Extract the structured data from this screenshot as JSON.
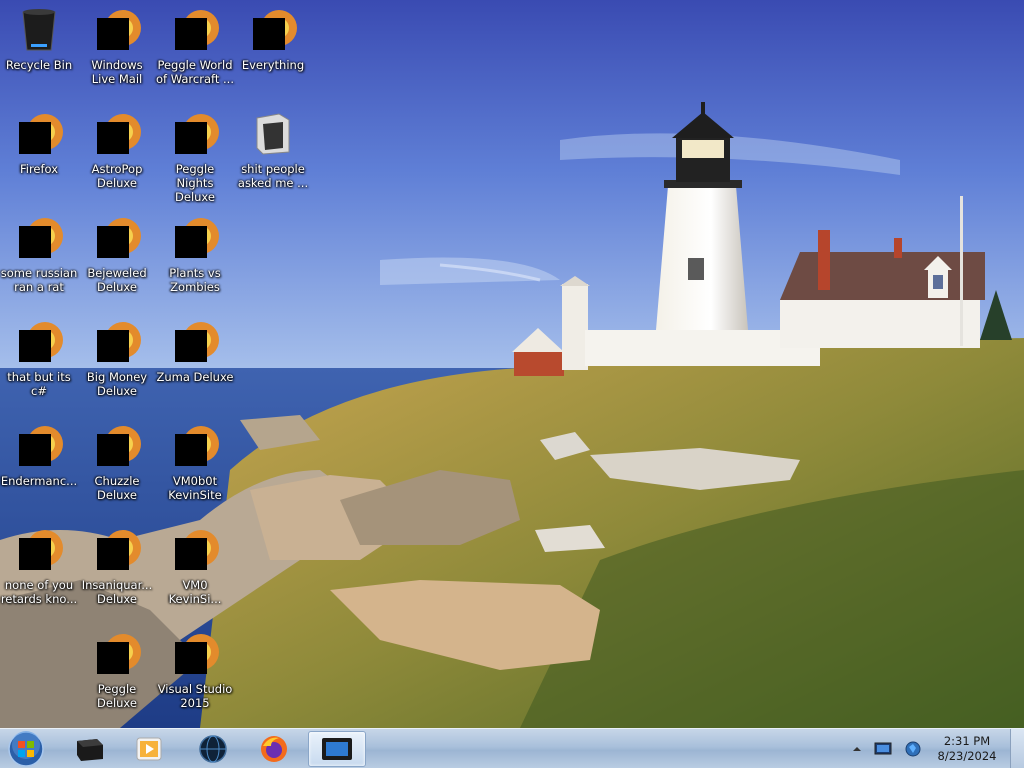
{
  "desktop": {
    "icons": [
      {
        "label": "Recycle Bin",
        "icon": "recycle-bin-icon",
        "redacted": false
      },
      {
        "label": "Windows Live Mail",
        "icon": "windows-live-mail-icon",
        "redacted": true
      },
      {
        "label": "Peggle World of Warcraft ...",
        "icon": "peggle-wow-icon",
        "redacted": true
      },
      {
        "label": "Everything",
        "icon": "everything-search-icon",
        "redacted": true
      },
      {
        "label": "Firefox",
        "icon": "firefox-icon",
        "redacted": true
      },
      {
        "label": "AstroPop Deluxe",
        "icon": "astropop-icon",
        "redacted": true
      },
      {
        "label": "Peggle Nights Deluxe",
        "icon": "peggle-nights-icon",
        "redacted": true
      },
      {
        "label": "shit people asked me ...",
        "icon": "folder-icon",
        "redacted": false
      },
      {
        "label": "some russian ran a rat",
        "icon": "vlc-style-file-icon",
        "redacted": true
      },
      {
        "label": "Bejeweled Deluxe",
        "icon": "bejeweled-icon",
        "redacted": true
      },
      {
        "label": "Plants vs Zombies",
        "icon": "plants-vs-zombies-icon",
        "redacted": true
      },
      {
        "label": "that but its c#",
        "icon": "copies-icon",
        "redacted": true
      },
      {
        "label": "Big Money Deluxe",
        "icon": "big-money-icon",
        "redacted": true
      },
      {
        "label": "Zuma Deluxe",
        "icon": "zuma-icon",
        "redacted": true
      },
      {
        "label": "Endermanc...",
        "icon": "terminal-app-icon",
        "redacted": true
      },
      {
        "label": "Chuzzle Deluxe",
        "icon": "chuzzle-icon",
        "redacted": true
      },
      {
        "label": "VM0b0t KevinSite",
        "icon": "vm-icon",
        "redacted": true
      },
      {
        "label": "none of you retards kno...",
        "icon": "opera-style-icon",
        "redacted": true
      },
      {
        "label": "Insaniquar... Deluxe",
        "icon": "insaniquarium-icon",
        "redacted": true
      },
      {
        "label": "VM0 KevinSi...",
        "icon": "vm-icon",
        "redacted": true
      },
      {
        "label": "Peggle Deluxe",
        "icon": "peggle-icon",
        "redacted": true
      },
      {
        "label": "Visual Studio 2015",
        "icon": "visual-studio-icon",
        "redacted": true
      }
    ]
  },
  "taskbar": {
    "start": "windows-orb-icon",
    "pinned": [
      {
        "name": "taskbar-app-1",
        "icon": "black-box-icon",
        "active": false
      },
      {
        "name": "taskbar-media-player",
        "icon": "media-player-icon",
        "active": false
      },
      {
        "name": "taskbar-app-3",
        "icon": "dark-globe-icon",
        "active": false
      },
      {
        "name": "taskbar-firefox",
        "icon": "firefox-icon",
        "active": false
      },
      {
        "name": "taskbar-app-5",
        "icon": "monitor-icon",
        "active": true
      }
    ],
    "tray": {
      "time": "2:31 PM",
      "date": "8/23/2024"
    }
  },
  "colors": {
    "sky_top": "#3b4fb0",
    "sky_bottom": "#8fb0e6",
    "sea": "#2d4f9a",
    "grass": "#a7953f",
    "taskbar": "#a9c0db"
  }
}
